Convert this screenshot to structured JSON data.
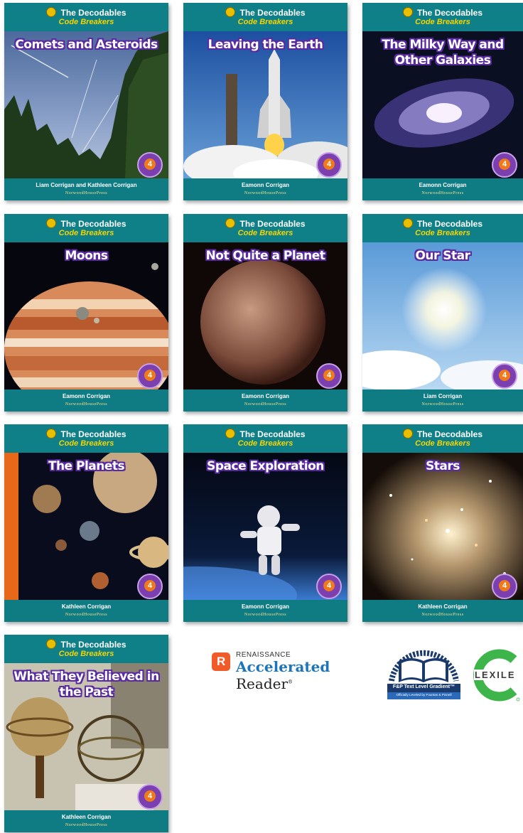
{
  "series": {
    "name": "The Decodables",
    "subtitle": "Code Breakers",
    "publisher": "NorwoodHousePress"
  },
  "books": [
    {
      "title": "Comets and Asteroids",
      "author": "Liam Corrigan and Kathleen Corrigan",
      "phonics_level": "4"
    },
    {
      "title": "Leaving the Earth",
      "author": "Eamonn Corrigan",
      "phonics_level": "4"
    },
    {
      "title": "The Milky Way and Other Galaxies",
      "author": "Eamonn Corrigan",
      "phonics_level": "4"
    },
    {
      "title": "Moons",
      "author": "Eamonn Corrigan",
      "phonics_level": "4"
    },
    {
      "title": "Not Quite a Planet",
      "author": "Eamonn Corrigan",
      "phonics_level": "4"
    },
    {
      "title": "Our Star",
      "author": "Liam Corrigan",
      "phonics_level": "4"
    },
    {
      "title": "The Planets",
      "author": "Kathleen Corrigan",
      "phonics_level": "4"
    },
    {
      "title": "Space Exploration",
      "author": "Eamonn Corrigan",
      "phonics_level": "4"
    },
    {
      "title": "Stars",
      "author": "Kathleen Corrigan",
      "phonics_level": "4"
    },
    {
      "title": "What They Believed in the Past",
      "author": "Kathleen Corrigan",
      "phonics_level": "4"
    }
  ],
  "logos": {
    "renaissance": "RENAISSANCE",
    "accelerated": "Accelerated",
    "reader": "Reader",
    "fp_title": "F&P Text Level Gradient™",
    "fp_sub": "Officially Leveled by Fountas & Pinnell",
    "lexile": "LEXILE"
  },
  "colors": {
    "teal": "#0f7c84",
    "yellow": "#f5d400",
    "title_outline": "#5a2aa0",
    "badge_purple": "#7b3fb0",
    "badge_orange": "#f07a1a",
    "ar_blue": "#1b75bb",
    "ar_orange": "#f15a29",
    "fp_navy": "#1a3a6e",
    "lexile_green": "#3db54a"
  }
}
